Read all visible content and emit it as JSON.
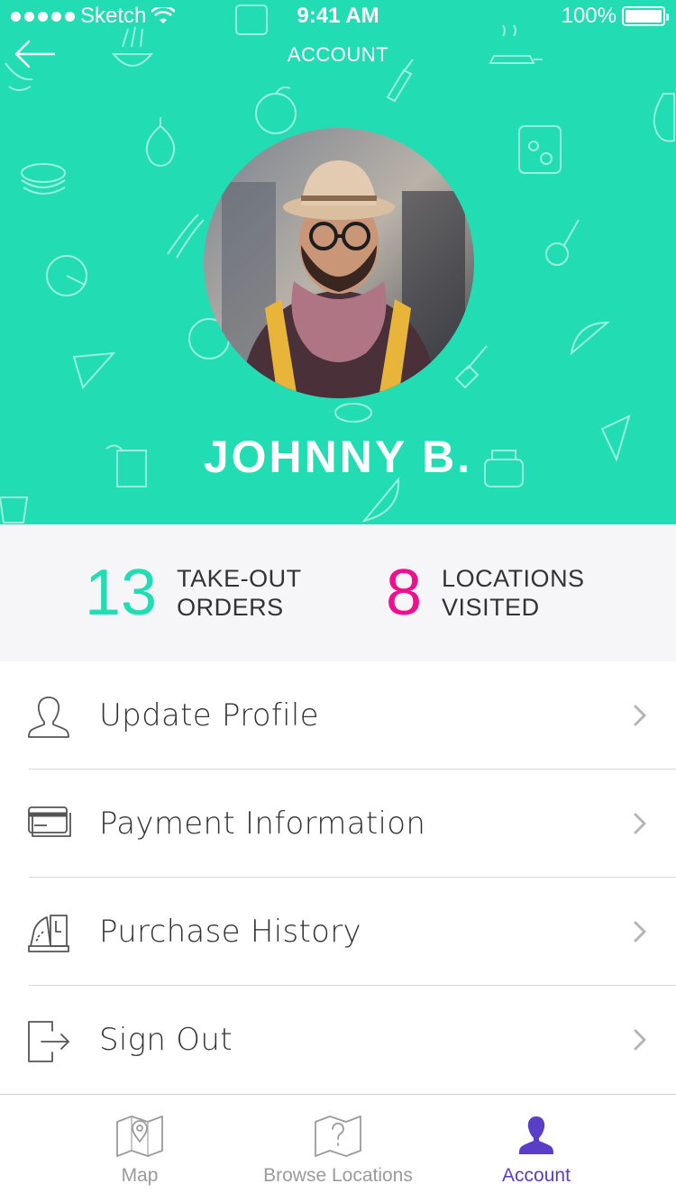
{
  "status_bar": {
    "carrier": "Sketch",
    "time": "9:41 AM",
    "battery": "100%",
    "battery_level": 1.0
  },
  "nav": {
    "title": "ACCOUNT",
    "back_icon": "arrow-left-icon"
  },
  "profile": {
    "name": "JOHNNY B.",
    "avatar_icon": "profile-photo"
  },
  "stats": {
    "orders": {
      "value": "13",
      "line1": "TAKE-OUT",
      "line2": "ORDERS",
      "color": "#22dcb3"
    },
    "locations": {
      "value": "8",
      "line1": "LOCATIONS",
      "line2": "VISITED",
      "color": "#ef0f8f"
    }
  },
  "menu": {
    "items": [
      {
        "label": "Update Profile",
        "icon": "user-icon"
      },
      {
        "label": "Payment Information",
        "icon": "credit-card-icon"
      },
      {
        "label": "Purchase History",
        "icon": "cash-register-icon"
      },
      {
        "label": "Sign Out",
        "icon": "sign-out-icon"
      }
    ],
    "chevron_icon": "chevron-right-icon"
  },
  "tabbar": {
    "tabs": [
      {
        "label": "Map",
        "icon": "map-icon",
        "active": false
      },
      {
        "label": "Browse Locations",
        "icon": "map-question-icon",
        "active": false
      },
      {
        "label": "Account",
        "icon": "person-icon",
        "active": true
      }
    ]
  },
  "colors": {
    "header_bg": "#22dcb3",
    "accent_teal": "#22dcb3",
    "accent_pink": "#ef0f8f",
    "active_tab": "#5a3ec8",
    "stats_bg": "#f6f6f8"
  }
}
